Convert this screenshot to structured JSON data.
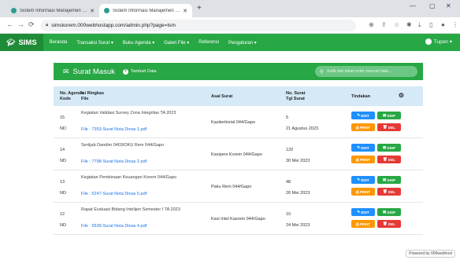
{
  "browser": {
    "tabs": [
      {
        "title": "Sistem Informasi Manajemen Sur..."
      },
      {
        "title": "Sistem Informasi Manajemen Sur..."
      }
    ],
    "url": "simskorem.000webhostapp.com/admin.php?page=tsm"
  },
  "navbar": {
    "brand": "SIMS",
    "menu": [
      {
        "label": "Beranda"
      },
      {
        "label": "Transaksi Surat ▾"
      },
      {
        "label": "Buku Agenda ▾"
      },
      {
        "label": "Galeri File ▾"
      },
      {
        "label": "Referensi"
      },
      {
        "label": "Pengaturan ▾"
      }
    ],
    "user": "Tupon ▾"
  },
  "panel": {
    "title": "Surat Masuk",
    "add_label": "Tambah Data",
    "search_placeholder": "Ketik dan tekan enter mencari data..."
  },
  "table": {
    "headers": {
      "agenda": "No. Agenda",
      "kode": "Kode",
      "ringkas": "Isi Ringkas",
      "file": "File",
      "asal": "Asal Surat",
      "nosurat": "No. Surat",
      "tgl": "Tgl Surat",
      "tindakan": "Tindakan"
    },
    "rows": [
      {
        "agenda": "15",
        "kode": "ND",
        "ringkas": "Kegiatan Validasi Survey Zona Integritas TA 2023",
        "file": "File : 7353-Surat Nota Dinas 1.pdf",
        "asal": "Kasiteritorial 044/Gapo",
        "nosurat": "5",
        "tgl": "21 Agustus 2023"
      },
      {
        "agenda": "14",
        "kode": "ND",
        "ringkas": "Sertijab Dandim 0403/OKU Rem 044/Gapo",
        "file": "File : 7798-Surat Nota Dinas 2.pdf",
        "asal": "Kasipers Korem 044/Gapo",
        "nosurat": "120",
        "tgl": "30 Mei 2023"
      },
      {
        "agenda": "13",
        "kode": "ND",
        "ringkas": "Kegiatan Pembinaan Keuangan Korem 044/Gapo",
        "file": "File : 5247-Surat Nota Dinas 5.pdf",
        "asal": "Paku Rem 044/Gapo",
        "nosurat": "48",
        "tgl": "26 Mei 2023"
      },
      {
        "agenda": "12",
        "kode": "ND",
        "ringkas": "Rapat Evaluasi Bidang Intelijen Semester I TA 2023",
        "file": "File : 5539-Surat Nota Dinas 4.pdf",
        "asal": "Kasi Intel Kasrem 044/Gapo",
        "nosurat": "10",
        "tgl": "24 Mei 2023"
      }
    ],
    "buttons": {
      "edit": "EDIT",
      "disp": "DISP",
      "print": "PRINT",
      "del": "DEL"
    }
  },
  "footer": {
    "powered": "Powered by 000webhost"
  }
}
